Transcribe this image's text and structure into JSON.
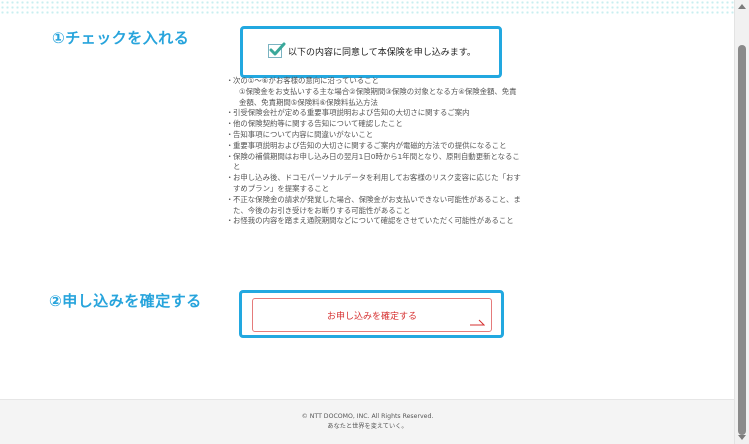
{
  "steps": {
    "step1_label": "①チェックを入れる",
    "step2_label": "②申し込みを確定する"
  },
  "agreement": {
    "checked": true,
    "label": "以下の内容に同意して本保険を申し込みます。"
  },
  "conditions": [
    {
      "text": "次の①～⑥がお客様の意向に沿っていること",
      "sub": "①保険金をお支払いする主な場合②保険期間③保険の対象となる方④保険金額、免責金額、免責期間⑤保険料⑥保険料払込方法"
    },
    {
      "text": "引受保険会社が定める重要事項説明および告知の大切さに関するご案内"
    },
    {
      "text": "他の保険契約等に関する告知について確認したこと"
    },
    {
      "text": "告知事項について内容に間違いがないこと"
    },
    {
      "text": "重要事項説明および告知の大切さに関するご案内が電磁的方法での提供になること"
    },
    {
      "text": "保険の補償期間はお申し込み日の翌月1日0時から1年間となり、原則自動更新となること"
    },
    {
      "text": "お申し込み後、ドコモパーソナルデータを利用してお客様のリスク変容に応じた「おすすめプラン」を提案すること"
    },
    {
      "text": "不正な保険金の請求が発覚した場合、保険金がお支払いできない可能性があること、また、今後のお引き受けをお断りする可能性があること"
    },
    {
      "text": "お怪我の内容を踏まえ通院期間などについて確認をさせていただく可能性があること"
    }
  ],
  "confirm_button": {
    "label": "お申し込みを確定する"
  },
  "footer": {
    "copyright": "© NTT DOCOMO, INC. All Rights Reserved.",
    "tagline": "あなたと世界を変えていく。"
  },
  "colors": {
    "step_label": "#27a4dc",
    "highlight_border": "#22a8e0",
    "check": "#3aa89a",
    "button_text": "#d63030",
    "button_border": "#e57b7b"
  }
}
